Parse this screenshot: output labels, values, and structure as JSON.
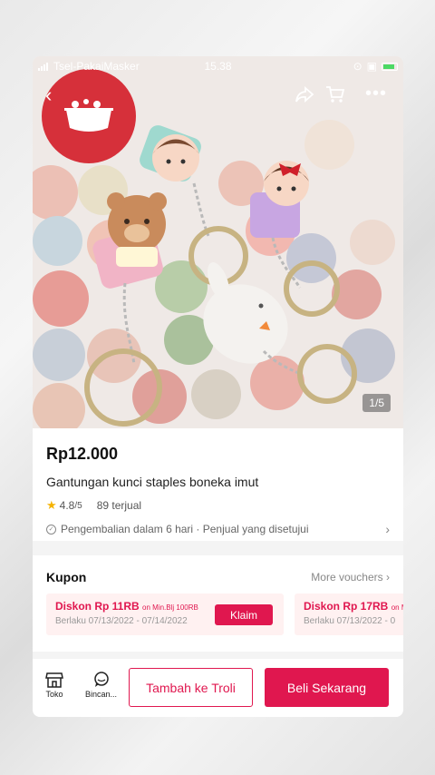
{
  "status_bar": {
    "carrier": "Tsel-PakaiMasker",
    "time": "15.38"
  },
  "icons": {
    "back": "back-arrow-icon",
    "share": "share-icon",
    "cart": "cart-icon",
    "more": "more-icon",
    "store": "store-icon",
    "chat": "chat-icon"
  },
  "gallery": {
    "counter": "1/5"
  },
  "product": {
    "price": "Rp12.000",
    "title": "Gantungan kunci staples boneka imut",
    "rating": "4.8",
    "rating_max": "/5",
    "sold": "89 terjual",
    "returns": "Pengembalian dalam 6 hari · Penjual yang disetujui"
  },
  "coupons": {
    "label": "Kupon",
    "more": "More vouchers",
    "items": [
      {
        "title": "Diskon Rp 11RB",
        "cond": "on Min.Blj 100RB",
        "valid": "Berlaku 07/13/2022 - 07/14/2022",
        "button": "Klaim"
      },
      {
        "title": "Diskon Rp 17RB",
        "cond": "on M",
        "valid": "Berlaku 07/13/2022 - 0"
      }
    ]
  },
  "bottom_bar": {
    "store_label": "Toko",
    "chat_label": "Bincan...",
    "add_to_cart": "Tambah ke Troli",
    "buy_now": "Beli Sekarang"
  },
  "colors": {
    "accent": "#e0174f",
    "logo_red": "#d6303a",
    "star": "#f5b301"
  }
}
